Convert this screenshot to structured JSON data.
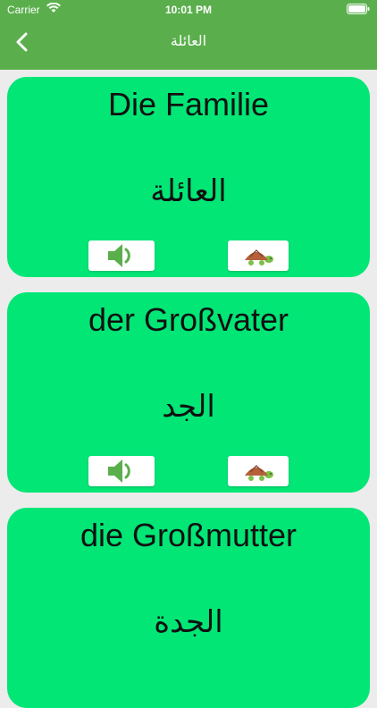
{
  "status_bar": {
    "carrier": "Carrier",
    "time": "10:01 PM"
  },
  "nav": {
    "title": "العائلة",
    "back_icon": "chevron-left-icon"
  },
  "cards": [
    {
      "german": "Die Familie",
      "arabic": "العائلة"
    },
    {
      "german": "der Großvater",
      "arabic": "الجد"
    },
    {
      "german": "die Großmutter",
      "arabic": "الجدة"
    }
  ],
  "colors": {
    "header": "#5aaf4c",
    "card": "#02e676",
    "background": "#ececec",
    "speaker": "#5aaf4c",
    "turtle_shell": "#b5603a",
    "turtle_body": "#7cc04a"
  },
  "icons": {
    "sound": "speaker-icon",
    "slow": "turtle-icon"
  }
}
